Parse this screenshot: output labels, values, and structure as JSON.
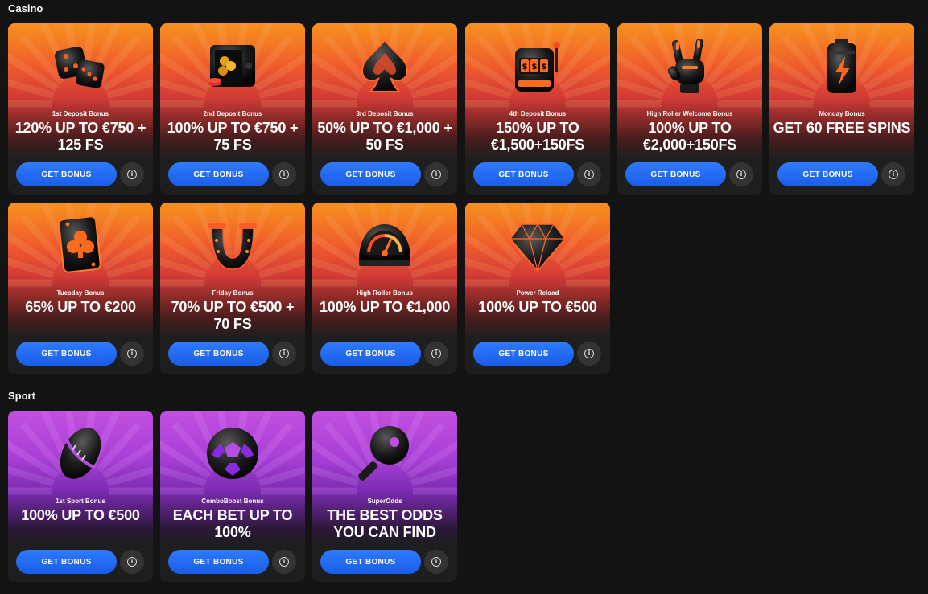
{
  "casino": {
    "title": "Casino",
    "cards": [
      {
        "name": "1st Deposit Bonus",
        "offer": "120% UP TO €750 + 125 FS",
        "icon": "dice-icon",
        "button": "GET BONUS"
      },
      {
        "name": "2nd Deposit Bonus",
        "offer": "100% UP TO €750 + 75 FS",
        "icon": "safe-icon",
        "button": "GET BONUS"
      },
      {
        "name": "3rd Deposit Bonus",
        "offer": "50% UP TO €1,000 + 50 FS",
        "icon": "spade-icon",
        "button": "GET BONUS"
      },
      {
        "name": "4th Deposit Bonus",
        "offer": "150% UP TO €1,500+150FS",
        "icon": "slot-machine-icon",
        "button": "GET BONUS"
      },
      {
        "name": "High Roller Welcome Bonus",
        "offer": "100% UP TO €2,000+150FS",
        "icon": "rock-hand-icon",
        "button": "GET BONUS"
      },
      {
        "name": "Monday Bonus",
        "offer": "GET 60 FREE SPINS",
        "icon": "battery-icon",
        "button": "GET BONUS"
      },
      {
        "name": "Tuesday Bonus",
        "offer": "65% UP TO €200",
        "icon": "card-club-icon",
        "button": "GET BONUS"
      },
      {
        "name": "Friday Bonus",
        "offer": "70% UP TO €500 + 70 FS",
        "icon": "horseshoe-icon",
        "button": "GET BONUS"
      },
      {
        "name": "High Roller Bonus",
        "offer": "100% UP TO €1,000",
        "icon": "speedometer-icon",
        "button": "GET BONUS"
      },
      {
        "name": "Power Reload",
        "offer": "100% UP TO €500",
        "icon": "diamond-icon",
        "button": "GET BONUS"
      }
    ]
  },
  "sport": {
    "title": "Sport",
    "cards": [
      {
        "name": "1st Sport Bonus",
        "offer": "100% UP TO €500",
        "icon": "football-icon",
        "button": "GET BONUS"
      },
      {
        "name": "ComboBoost Bonus",
        "offer": "EACH BET UP TO 100%",
        "icon": "soccer-ball-icon",
        "button": "GET BONUS"
      },
      {
        "name": "SuperOdds",
        "offer": "THE BEST ODDS YOU CAN FIND",
        "icon": "ping-pong-icon",
        "button": "GET BONUS"
      }
    ]
  },
  "info_symbol": "i",
  "colors": {
    "background": "#131313",
    "casino_gradient_top": "#f7921e",
    "casino_gradient_mid": "#d23a36",
    "sport_gradient_top": "#c24fe0",
    "sport_gradient_mid": "#7a2bb0",
    "button_blue": "#1a5ce6"
  }
}
